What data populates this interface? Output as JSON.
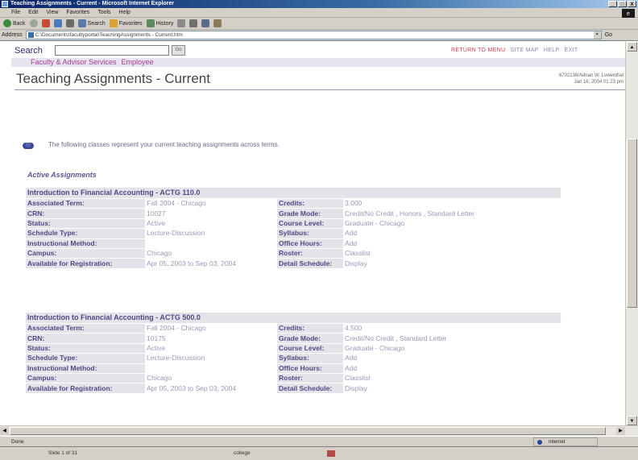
{
  "window": {
    "title": "Teaching Assignments - Current - Microsoft Internet Explorer",
    "buttons": [
      "_",
      "□",
      "X"
    ]
  },
  "menu": [
    "File",
    "Edit",
    "View",
    "Favorites",
    "Tools",
    "Help"
  ],
  "toolbar": {
    "back": "Back",
    "search": "Search",
    "favorites": "Favorites",
    "history": "History"
  },
  "address": {
    "label": "Address",
    "value": "C:\\Documents\\facultyportal\\TeachingAssignments - Current.htm",
    "go": "Go"
  },
  "page": {
    "search_label": "Search",
    "go_button": "Go",
    "top_links": [
      "RETURN TO MENU",
      "SITE MAP",
      "HELP",
      "EXIT"
    ],
    "breadcrumb": [
      "Faculty & Advisor Services",
      "Employee"
    ],
    "title": "Teaching Assignments - Current",
    "user_line1": "6702136/Adrian W. Lowenthal",
    "user_line2": "Jan 16, 2004 01:23 pm",
    "info_text": "The following classes represent your current teaching assignments across terms.",
    "section": "Active Assignments"
  },
  "courses": [
    {
      "title": "Introduction to Financial Accounting - ACTG 110.0",
      "rows": [
        [
          "Associated Term:",
          "Fall 2004 - Chicago",
          "Credits:",
          "3.000"
        ],
        [
          "CRN:",
          "10027",
          "Grade Mode:",
          "Credit/No Credit , Honors , Standard Letter"
        ],
        [
          "Status:",
          "Active",
          "Course Level:",
          "Graduate - Chicago"
        ],
        [
          "Schedule Type:",
          "Lecture-Discussion",
          "Syllabus:",
          "Add"
        ],
        [
          "Instructional Method:",
          "",
          "Office Hours:",
          "Add"
        ],
        [
          "Campus:",
          "Chicago",
          "Roster:",
          "Classlist"
        ],
        [
          "Available for Registration:",
          "Apr 05, 2003 to Sep 03, 2004",
          "Detail Schedule:",
          "Display"
        ]
      ]
    },
    {
      "title": "Introduction to Financial Accounting - ACTG 500.0",
      "rows": [
        [
          "Associated Term:",
          "Fall 2004 - Chicago",
          "Credits:",
          "4.500"
        ],
        [
          "CRN:",
          "10175",
          "Grade Mode:",
          "Credit/No Credit , Standard Letter"
        ],
        [
          "Status:",
          "Active",
          "Course Level:",
          "Graduate - Chicago"
        ],
        [
          "Schedule Type:",
          "Lecture-Discussion",
          "Syllabus:",
          "Add"
        ],
        [
          "Instructional Method:",
          "",
          "Office Hours:",
          "Add"
        ],
        [
          "Campus:",
          "Chicago",
          "Roster:",
          "Classlist"
        ],
        [
          "Available for Registration:",
          "Apr 05, 2003 to Sep 03, 2004",
          "Detail Schedule:",
          "Display"
        ]
      ]
    }
  ],
  "status": {
    "text": "Done",
    "zone": "Internet"
  },
  "taskbar": [
    "Slide 1 of 31",
    "college"
  ]
}
